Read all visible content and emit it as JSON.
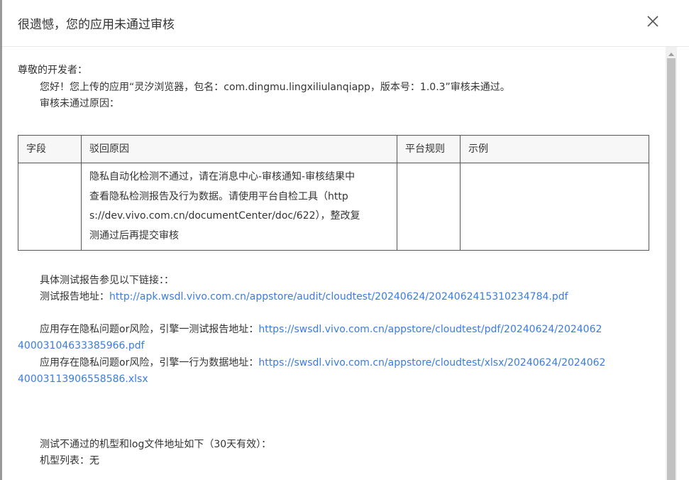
{
  "dialog": {
    "title": "很遗憾，您的应用未通过审核"
  },
  "greeting": "尊敬的开发者：",
  "intro": "您好！您上传的应用“灵汐浏览器，包名：com.dingmu.lingxiliulanqiapp，版本号：1.0.3”审核未通过。",
  "reason_heading": "审核未通过原因：",
  "table": {
    "headers": [
      "字段",
      "驳回原因",
      "平台规则",
      "示例"
    ],
    "rows": [
      {
        "field": "",
        "reason_lines": [
          "隐私自动化检测不通过，请在消息中心-审核通知-审核结果中",
          "查看隐私检测报告及行为数据。请使用平台自检工具（http",
          "s://dev.vivo.com.cn/documentCenter/doc/622），整改复",
          "测通过后再提交审核"
        ],
        "rule": "",
        "example": ""
      }
    ]
  },
  "report": {
    "intro": "具体测试报告参见以下链接：：",
    "address_label": "测试报告地址：",
    "address_url": "http://apk.wsdl.vivo.com.cn/appstore/audit/cloudtest/20240624/20240624153102347​84.pdf"
  },
  "privacy": [
    {
      "label": "应用存在隐私问题or风险，引擎一测试报告地址：",
      "url_line1": "https://swsdl.vivo.com.cn/appstore/cloudtest/pdf/20240624/2024062",
      "url_line2": "40003104633385966.pdf"
    },
    {
      "label": "应用存在隐私问题or风险，引擎一行为数据地址：",
      "url_line1": "https://swsdl.vivo.com.cn/appstore/cloudtest/xlsx/20240624/2024062",
      "url_line2": "40003113906558586.xlsx"
    }
  ],
  "devices": {
    "heading": "测试不通过的机型和log文件地址如下（30天有效）：",
    "list_label": "机型列表：无"
  }
}
